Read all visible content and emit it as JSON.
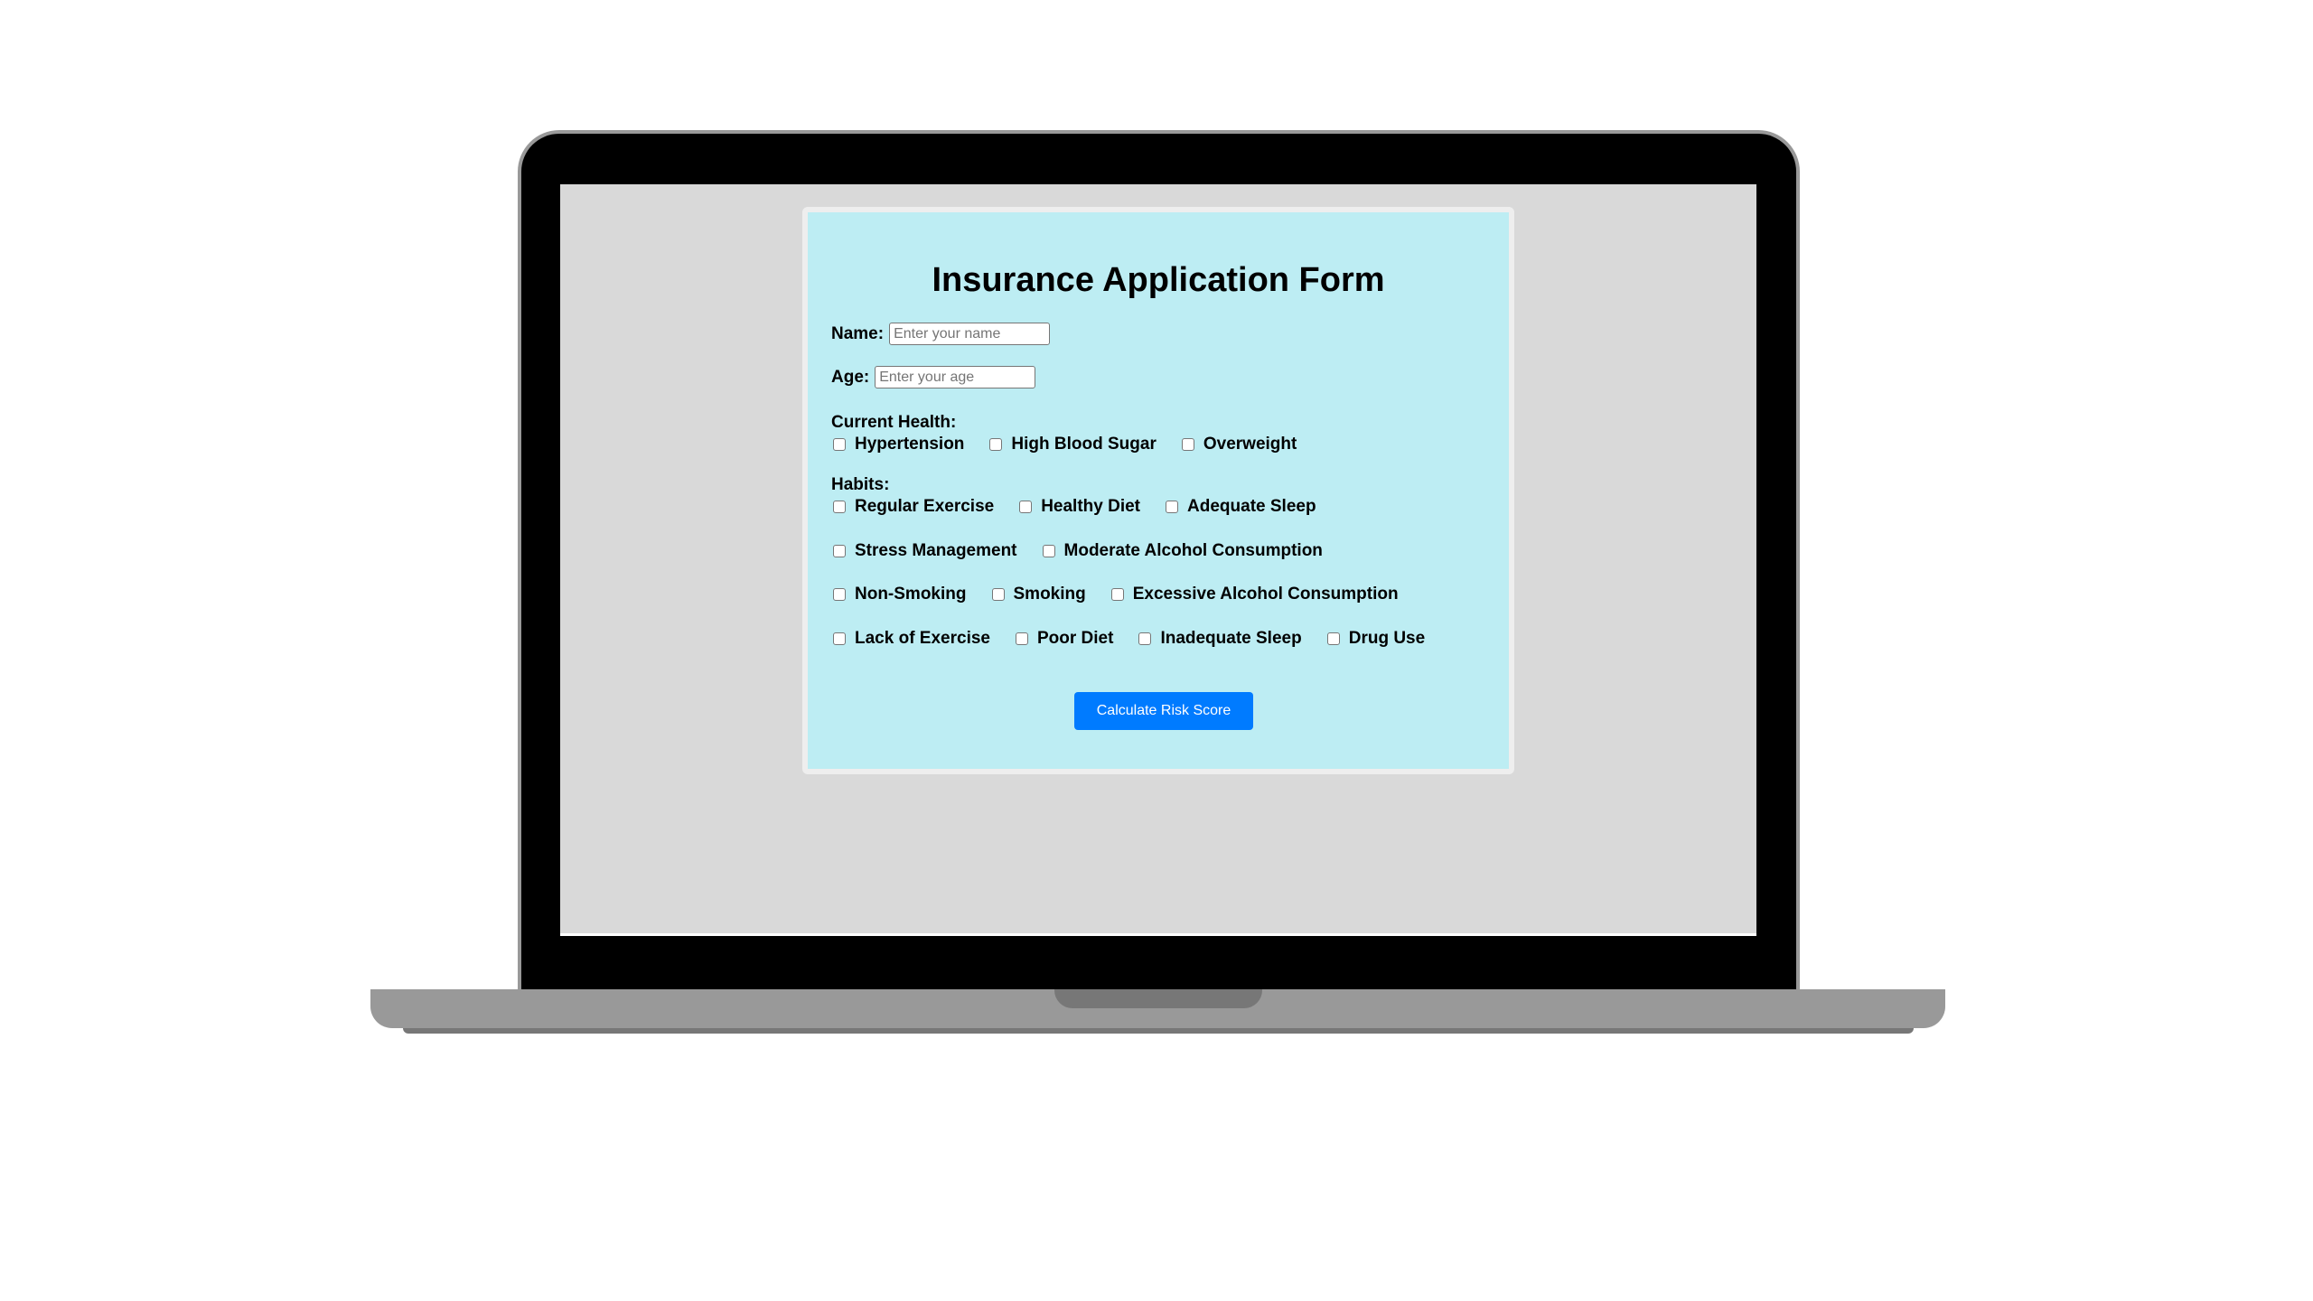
{
  "form": {
    "title": "Insurance Application Form",
    "name_label": "Name:",
    "name_placeholder": "Enter your name",
    "name_value": "",
    "age_label": "Age:",
    "age_placeholder": "Enter your age",
    "age_value": "",
    "current_health_label": "Current Health:",
    "current_health_options": [
      "Hypertension",
      "High Blood Sugar",
      "Overweight"
    ],
    "habits_label": "Habits:",
    "habits_rows": [
      [
        "Regular Exercise",
        "Healthy Diet",
        "Adequate Sleep"
      ],
      [
        "Stress Management",
        "Moderate Alcohol Consumption"
      ],
      [
        "Non-Smoking",
        "Smoking",
        "Excessive Alcohol Consumption"
      ],
      [
        "Lack of Exercise",
        "Poor Diet",
        "Inadequate Sleep",
        "Drug Use"
      ]
    ],
    "submit_label": "Calculate Risk Score"
  },
  "colors": {
    "form_background": "#bdedf3",
    "button": "#007bff",
    "screen_background": "#d9d9d9"
  }
}
